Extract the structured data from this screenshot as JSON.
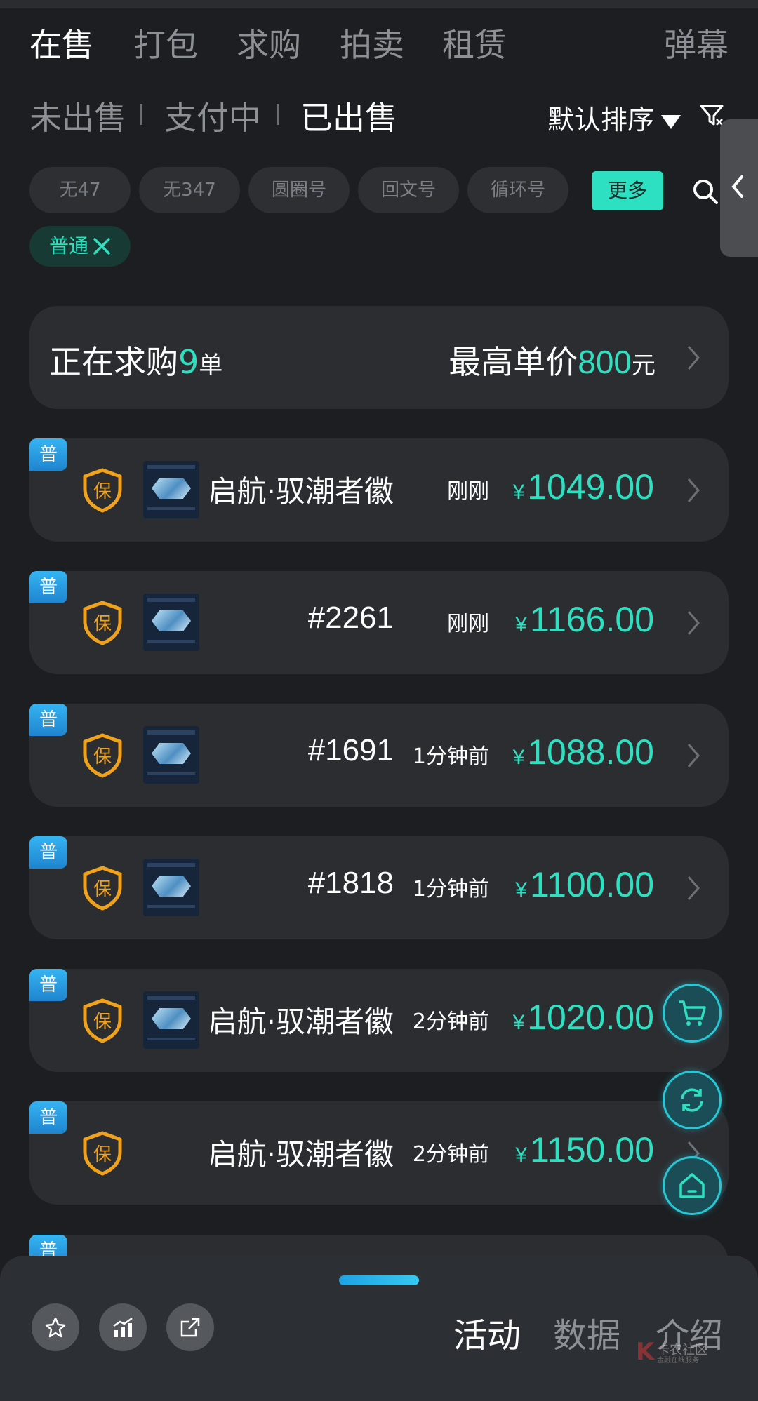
{
  "top_tabs": [
    "在售",
    "打包",
    "求购",
    "拍卖",
    "租赁"
  ],
  "active_top_tab": "在售",
  "danmu_label": "弹幕",
  "sub_tabs": [
    "未出售",
    "支付中",
    "已出售"
  ],
  "active_sub_tab": "已出售",
  "sort_label": "默认排序",
  "filter_chips": [
    "无47",
    "无347",
    "圆圈号",
    "回文号",
    "循环号"
  ],
  "more_button_label": "更多",
  "active_filter": "普通",
  "want_card": {
    "left_label": "正在求购",
    "count": "9",
    "count_unit": "单",
    "right_label": "最高单价",
    "max_price": "800",
    "price_unit": "元"
  },
  "listings": [
    {
      "badge": "普",
      "shield": "保",
      "name": "启航·驭潮者徽",
      "time": "刚刚",
      "currency": "¥",
      "price": "1049.00",
      "has_thumb": true
    },
    {
      "badge": "普",
      "shield": "保",
      "name": "#2261",
      "time": "刚刚",
      "currency": "¥",
      "price": "1166.00",
      "has_thumb": true
    },
    {
      "badge": "普",
      "shield": "保",
      "name": "#1691",
      "time": "1分钟前",
      "currency": "¥",
      "price": "1088.00",
      "has_thumb": true
    },
    {
      "badge": "普",
      "shield": "保",
      "name": "#1818",
      "time": "1分钟前",
      "currency": "¥",
      "price": "1100.00",
      "has_thumb": true
    },
    {
      "badge": "普",
      "shield": "保",
      "name": "启航·驭潮者徽",
      "time": "2分钟前",
      "currency": "¥",
      "price": "1020.00",
      "has_thumb": true
    },
    {
      "badge": "普",
      "shield": "保",
      "name": "启航·驭潮者徽",
      "time": "2分钟前",
      "currency": "¥",
      "price": "1150.00",
      "has_thumb": false
    }
  ],
  "partial_badge": "普",
  "bottom_tabs": [
    "活动",
    "数据",
    "介绍"
  ],
  "active_bottom_tab": "活动",
  "watermark": {
    "mark": "K",
    "title": "卡农社区",
    "subtitle": "金融在线服务"
  },
  "colors": {
    "accent": "#2ee0c2",
    "background": "#1c1e21",
    "card": "#2b2d31",
    "badge": "#2a9be0",
    "shield": "#f0a21a"
  },
  "icons": [
    "filter-icon",
    "search-icon",
    "close-icon",
    "chevron-right-icon",
    "shield-icon",
    "cart-icon",
    "refresh-icon",
    "home-icon",
    "star-icon",
    "chart-icon",
    "share-icon"
  ]
}
